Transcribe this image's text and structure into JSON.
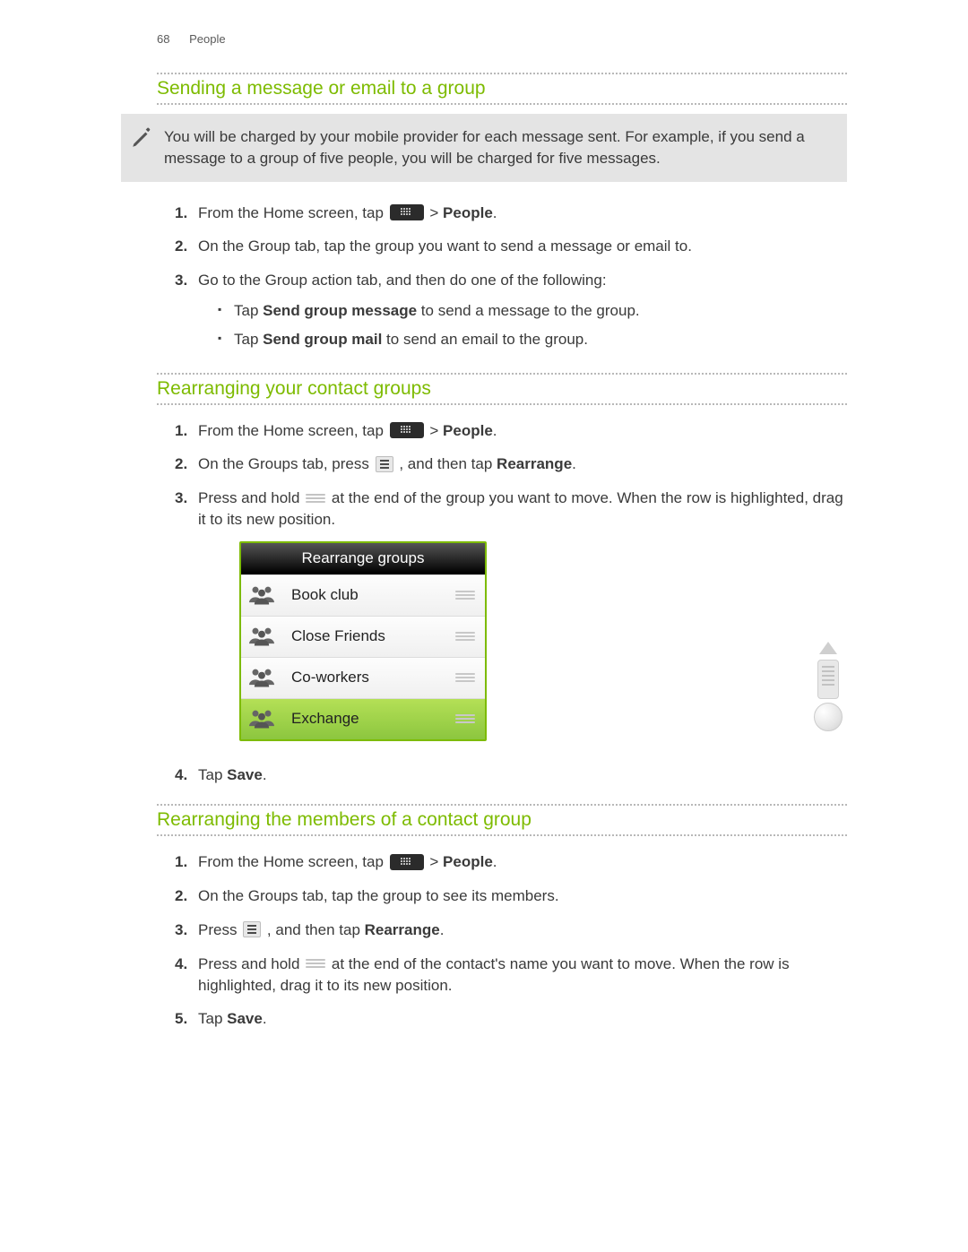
{
  "header": {
    "page_number": "68",
    "section": "People"
  },
  "s1": {
    "heading": "Sending a message or email to a group",
    "note": "You will be charged by your mobile provider for each message sent. For example, if you send a message to a group of five people, you will be charged for five messages.",
    "step1_a": "From the Home screen, tap ",
    "step1_b": " > ",
    "people": "People",
    "step1_c": ".",
    "step2": "On the Group tab, tap the group you want to send a message or email to.",
    "step3": "Go to the Group action tab, and then do one of the following:",
    "b1_a": "Tap ",
    "b1_s": "Send group message",
    "b1_b": " to send a message to the group.",
    "b2_a": "Tap ",
    "b2_s": "Send group mail",
    "b2_b": " to send an email to the group."
  },
  "s2": {
    "heading": "Rearranging your contact groups",
    "step1_a": "From the Home screen, tap ",
    "step1_b": " > ",
    "people": "People",
    "step1_c": ".",
    "step2_a": "On the Groups tab, press ",
    "step2_b": " , and then tap ",
    "rearrange": "Rearrange",
    "step2_c": ".",
    "step3_a": "Press and hold ",
    "step3_b": " at the end of the group you want to move. When the row is highlighted, drag it to its new position.",
    "widget": {
      "title": "Rearrange groups",
      "rows": [
        "Book club",
        "Close Friends",
        "Co-workers",
        "Exchange"
      ]
    },
    "step4_a": "Tap ",
    "save": "Save",
    "step4_b": "."
  },
  "s3": {
    "heading": "Rearranging the members of a contact group",
    "step1_a": "From the Home screen, tap ",
    "step1_b": " > ",
    "people": "People",
    "step1_c": ".",
    "step2": "On the Groups tab, tap the group to see its members.",
    "step3_a": "Press ",
    "step3_b": " , and then tap ",
    "rearrange": "Rearrange",
    "step3_c": ".",
    "step4_a": "Press and hold ",
    "step4_b": " at the end of the contact's name you want to move. When the row is highlighted, drag it to its new position.",
    "step5_a": "Tap ",
    "save": "Save",
    "step5_b": "."
  }
}
